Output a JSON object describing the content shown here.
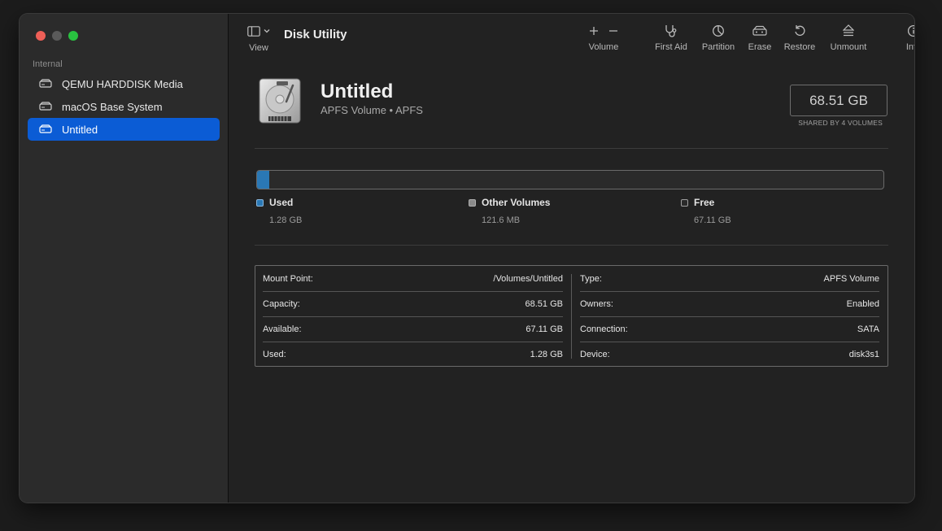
{
  "sidebar": {
    "section_label": "Internal",
    "items": [
      {
        "label": "QEMU HARDDISK Media",
        "selected": false
      },
      {
        "label": "macOS Base System",
        "selected": false
      },
      {
        "label": "Untitled",
        "selected": true
      }
    ]
  },
  "toolbar": {
    "view_label": "View",
    "app_title": "Disk Utility",
    "volume_label": "Volume",
    "first_aid_label": "First Aid",
    "partition_label": "Partition",
    "erase_label": "Erase",
    "restore_label": "Restore",
    "unmount_label": "Unmount",
    "info_label": "Info"
  },
  "volume": {
    "name": "Untitled",
    "subtitle": "APFS Volume • APFS",
    "capacity": "68.51 GB",
    "capacity_note": "SHARED BY 4 VOLUMES"
  },
  "usage": {
    "used_fraction": 0.019,
    "legend": [
      {
        "label": "Used",
        "value": "1.28 GB",
        "color": "#2a78b5"
      },
      {
        "label": "Other Volumes",
        "value": "121.6 MB",
        "color": "#8a8a8a"
      },
      {
        "label": "Free",
        "value": "67.11 GB",
        "color": "#2a2a2a"
      }
    ]
  },
  "info": {
    "left": [
      {
        "key": "Mount Point:",
        "value": "/Volumes/Untitled"
      },
      {
        "key": "Capacity:",
        "value": "68.51 GB"
      },
      {
        "key": "Available:",
        "value": "67.11 GB"
      },
      {
        "key": "Used:",
        "value": "1.28 GB"
      }
    ],
    "right": [
      {
        "key": "Type:",
        "value": "APFS Volume"
      },
      {
        "key": "Owners:",
        "value": "Enabled"
      },
      {
        "key": "Connection:",
        "value": "SATA"
      },
      {
        "key": "Device:",
        "value": "disk3s1"
      }
    ]
  },
  "colors": {
    "selection": "#0b5cd5",
    "used": "#2a78b5"
  }
}
